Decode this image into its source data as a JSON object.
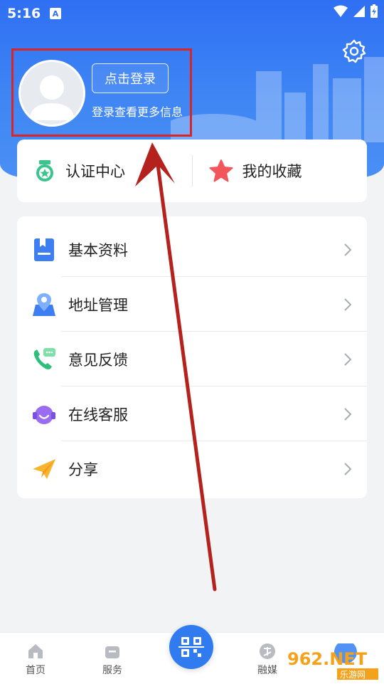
{
  "status_bar": {
    "time": "5:16",
    "badge": "A"
  },
  "profile": {
    "login_button": "点击登录",
    "subtitle": "登录查看更多信息"
  },
  "quick_actions": [
    {
      "label": "认证中心",
      "icon": "badge-star-icon"
    },
    {
      "label": "我的收藏",
      "icon": "star-icon"
    }
  ],
  "menu": [
    {
      "label": "基本资料",
      "icon": "profile-book-icon"
    },
    {
      "label": "地址管理",
      "icon": "map-pin-icon"
    },
    {
      "label": "意见反馈",
      "icon": "phone-chat-icon"
    },
    {
      "label": "在线客服",
      "icon": "headset-icon"
    },
    {
      "label": "分享",
      "icon": "paper-plane-icon"
    }
  ],
  "bottom_nav": [
    {
      "label": "首页",
      "icon": "home-icon"
    },
    {
      "label": "服务",
      "icon": "service-icon"
    },
    {
      "label": "融媒",
      "icon": "media-icon"
    }
  ],
  "watermark": {
    "main": "962.NET",
    "sub": "乐游网"
  },
  "colors": {
    "primary": "#2f7bef",
    "highlight": "#d82626",
    "arrow": "#b5221d"
  }
}
